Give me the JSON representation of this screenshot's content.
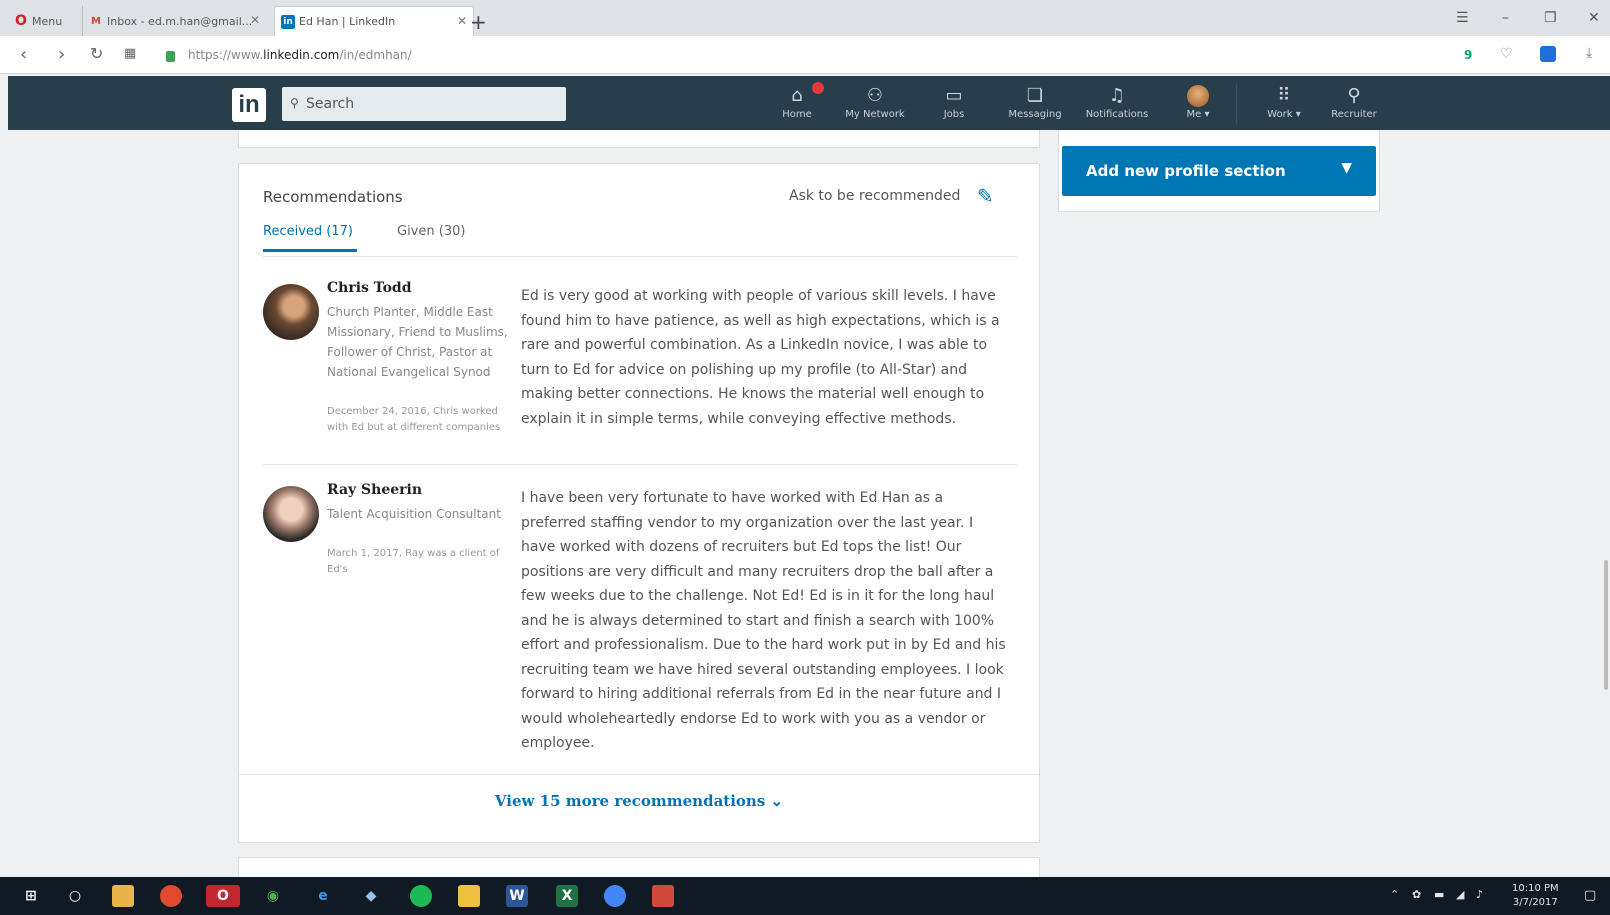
{
  "browser": {
    "tabs": [
      {
        "title": "Menu",
        "icon": "opera-icon"
      },
      {
        "title": "Inbox - ed.m.han@gmail...",
        "icon": "gmail-icon"
      },
      {
        "title": "Ed Han | LinkedIn",
        "icon": "linkedin-icon"
      }
    ],
    "url_prefix": "https://www.",
    "url_domain": "linkedin.com",
    "url_path": "/in/edmhan/",
    "ext_badge": "9"
  },
  "nav": {
    "logo": "in",
    "search_placeholder": "Search",
    "items": [
      {
        "label": "Home",
        "icon": "home-icon"
      },
      {
        "label": "My Network",
        "icon": "network-icon"
      },
      {
        "label": "Jobs",
        "icon": "briefcase-icon"
      },
      {
        "label": "Messaging",
        "icon": "messaging-icon"
      },
      {
        "label": "Notifications",
        "icon": "bell-icon"
      },
      {
        "label": "Me ▾",
        "icon": "avatar"
      },
      {
        "label": "Work ▾",
        "icon": "grid-icon"
      },
      {
        "label": "Recruiter",
        "icon": "recruiter-icon"
      }
    ]
  },
  "recommendations": {
    "title": "Recommendations",
    "ask_label": "Ask to be recommended",
    "tab_received": "Received (17)",
    "tab_given": "Given (30)",
    "items": [
      {
        "name": "Chris Todd",
        "role": "Church Planter, Middle East Missionary, Friend to Muslims, Follower of Christ, Pastor at National Evangelical Synod",
        "meta": "December 24, 2016, Chris worked with Ed but at different companies",
        "text": "Ed is very good at working with people of various skill levels. I have found him to have patience, as well as high expectations, which is a rare and powerful combination. As a LinkedIn novice, I was able to turn to Ed for advice on polishing up my profile (to All-Star) and making better connections. He knows the material well enough to explain it in simple terms, while conveying effective methods."
      },
      {
        "name": "Ray Sheerin",
        "role": "Talent Acquisition Consultant",
        "meta": "March 1, 2017, Ray was a client of Ed's",
        "text": "I have been very fortunate to have worked with Ed Han as a preferred staffing vendor to my organization over the last year. I have worked with dozens of recruiters but Ed tops the list! Our positions are very difficult and many recruiters drop the ball after a few weeks due to the challenge. Not Ed! Ed is in it for the long haul and he is always determined to start and finish a search with 100% effort and professionalism. Due to the hard work put in by Ed and his recruiting team we have hired several outstanding employees. I look forward to hiring additional referrals from Ed in the near future and I would wholeheartedly endorse Ed to work with you as a vendor or employee."
      }
    ],
    "view_more": "View 15 more recommendations ⌄"
  },
  "right_rail": {
    "add_section_label": "Add new profile section"
  },
  "taskbar": {
    "time": "10:10 PM",
    "date": "3/7/2017"
  },
  "colors": {
    "linkedin_nav": "#283e4a",
    "linkedin_blue": "#0077b5",
    "link_blue": "#0073b1",
    "taskbar": "#101a24"
  }
}
